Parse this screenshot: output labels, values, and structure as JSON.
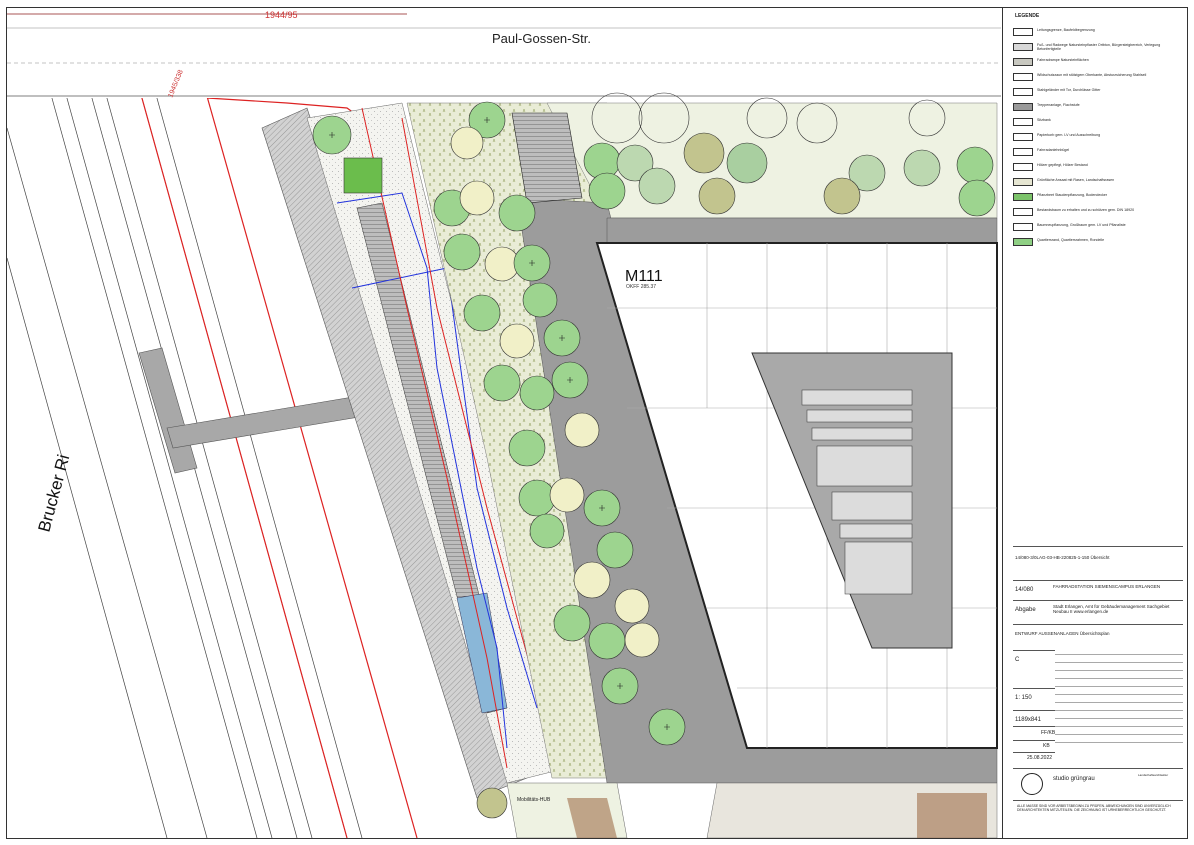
{
  "plan": {
    "street_top": "Paul-Gossen-Str.",
    "street_left": "Brucker Ri",
    "building_label": "M111",
    "building_sub": "OKFF 285.37",
    "parcel_label": "1944/95",
    "parcel_label2": "1945/338",
    "hub_label": "Mobilitäts-HUB"
  },
  "legend": {
    "title": "LEGENDE",
    "items": [
      {
        "text": "Leitungsgrenze, Baufeldbegrenzung",
        "color": "#ffffff"
      },
      {
        "text": "Fuß- und Radwege Natursteinpflaster Ortbton, Bürgersteigbereich, Verlegung Betonfertigteile",
        "color": "#d8d8d8"
      },
      {
        "text": "Fahrradrampe Natursteinflächen",
        "color": "#c8c8c0"
      },
      {
        "text": "Wildschutzzaun mit stützigem Oberkante, Absturzsicherung Stahlseil",
        "color": "#ffffff"
      },
      {
        "text": "Stahlgeländer mit Tor, Durchlässe Gitter",
        "color": "#ffffff"
      },
      {
        "text": "Treppenanlage, Flachstufe",
        "color": "#9a9a9a"
      },
      {
        "text": "Sitzbank",
        "color": "#ffffff"
      },
      {
        "text": "Papierkorb gem. LV und Ausschreibung",
        "color": "#ffffff"
      },
      {
        "text": "Fahrradanlehnbügel",
        "color": "#ffffff"
      },
      {
        "text": "Hölzer gepflegt, Hölzer Bestand",
        "color": "#ffffff"
      },
      {
        "text": "Grünfläche Ansaat mit Rasen, Landschaftsrasen",
        "color": "#e6e6d2"
      },
      {
        "text": "Pflanzbeet Staudenpflanzung, Bodendecker",
        "color": "#7cc36a"
      },
      {
        "text": "Bestandsbaum zu erhalten und zu schützen gem. DIN 18920",
        "color": "#ffffff"
      },
      {
        "text": "Baumneupflanzung, Großbaum gem. LV und Pflanzliste",
        "color": "#ffffff"
      },
      {
        "text": "Quartiersrand, Quartiersrahmen, Rondelle",
        "color": "#8fd084"
      }
    ]
  },
  "titleblock": {
    "plan_no": "14/080-3/0LAG-03-HB-220825-1-150 Übersicht",
    "project_no": "14/080",
    "project_name": "FAHRRADSTATION SIEMENSCAMPUS ERLANGEN",
    "phase": "Abgabe",
    "client": "Stadt Erlangen, Amt für Gebäudemanagement Sachgebiet Neubau II www.erlangen.de",
    "plan_title": "ENTWURF AUSSENANLAGEN Übersichtsplan",
    "index": "C",
    "scale": "1: 150",
    "format": "1189x841",
    "drawn": "FF/KB",
    "checked": "KB",
    "date": "25.08.2022",
    "office": "studio grüngrau",
    "office_sub": "Landschaftsarchitektur",
    "disclaimer": "ALLE MASSE SIND VOR ARBEITSBEGINN ZU PRÜFEN. ABWEICHUNGEN SIND UNVERZÜGLICH DEM ARCHITEKTEN MITZUTEILEN. DIE ZEICHNUNG IST URHEBERRECHTLICH GESCHÜTZT."
  }
}
